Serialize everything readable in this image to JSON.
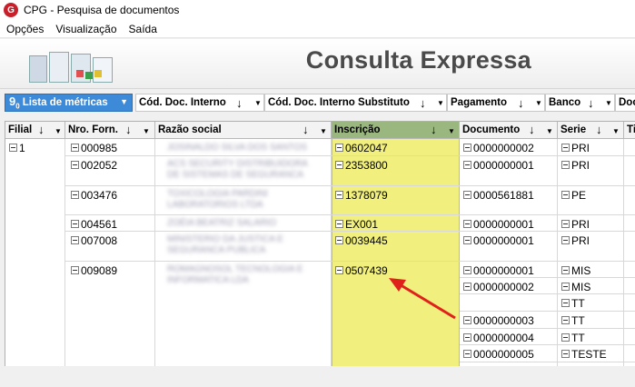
{
  "window": {
    "title": "CPG - Pesquisa de documentos",
    "icon": "cpg-logo-icon",
    "accent": "#c8202a"
  },
  "menu": [
    "Opções",
    "Visualização",
    "Saída"
  ],
  "banner": {
    "title": "Consulta Expressa",
    "graphic": "spreadsheet-grid-icon"
  },
  "group_bar": {
    "metric_button": "Lista de métricas",
    "columns": [
      "Cód. Doc. Interno",
      "Cód. Doc. Interno Substituto",
      "Pagamento",
      "Banco",
      "Doc"
    ]
  },
  "grid": {
    "headers": [
      "Filial",
      "Nro. Forn.",
      "Razão social",
      "Inscrição",
      "Documento",
      "Serie",
      "Ti"
    ],
    "highlight_color": "#f1f07e",
    "filial": "1",
    "rows": [
      {
        "forn": "000985",
        "razao": [
          "JOSINALDO SILVA DOS SANTOS"
        ],
        "insc": "0602047",
        "docs": [
          {
            "doc": "0000000002",
            "serie": "PRI"
          }
        ]
      },
      {
        "forn": "002052",
        "razao": [
          "ACS SECURITY DISTRIBUIDORA",
          "DE SISTEMAS DE SEGURANCA"
        ],
        "insc": "2353800",
        "docs": [
          {
            "doc": "0000000001",
            "serie": "PRI"
          }
        ]
      },
      {
        "forn": "003476",
        "razao": [
          "TOXICOLOGIA PARDINI",
          "LABORATORIOS LTDA"
        ],
        "insc": "1378079",
        "docs": [
          {
            "doc": "0000561881",
            "serie": "PE"
          }
        ]
      },
      {
        "forn": "004561",
        "razao": [
          "ZOÉIA BEATRIZ SALARIO"
        ],
        "insc": "EX001",
        "docs": [
          {
            "doc": "0000000001",
            "serie": "PRI"
          }
        ]
      },
      {
        "forn": "007008",
        "razao": [
          "MINISTERIO DA JUSTICA E",
          "SEGURANCA PUBLICA"
        ],
        "insc": "0039445",
        "docs": [
          {
            "doc": "0000000001",
            "serie": "PRI"
          }
        ]
      },
      {
        "forn": "009089",
        "razao": [
          "ROMAGNOSOL TECNOLOGIA E",
          "INFORMATICA LDA"
        ],
        "insc": "0507439",
        "docs": [
          {
            "doc": "0000000001",
            "serie": "MIS"
          },
          {
            "doc": "0000000002",
            "serie": "MIS"
          },
          {
            "doc": "",
            "serie": "TT"
          },
          {
            "doc": "0000000003",
            "serie": "TT"
          },
          {
            "doc": "0000000004",
            "serie": "TT"
          },
          {
            "doc": "0000000005",
            "serie": "TESTE"
          }
        ]
      }
    ]
  },
  "annotation": {
    "type": "red-arrow",
    "color": "#e0201a"
  }
}
